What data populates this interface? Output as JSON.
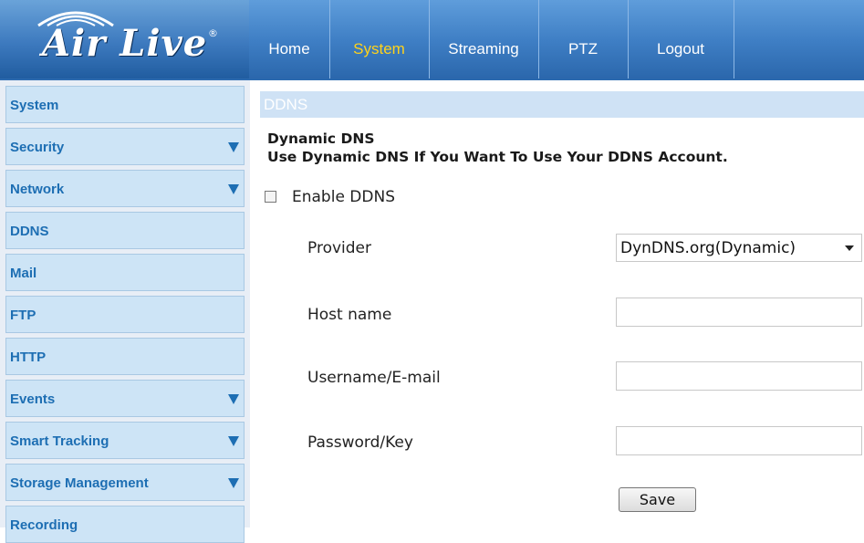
{
  "brand": {
    "logo_text": "Air Live",
    "logo_mark": "®"
  },
  "nav": {
    "tabs": [
      {
        "label": "Home"
      },
      {
        "label": "System",
        "active": true
      },
      {
        "label": "Streaming"
      },
      {
        "label": "PTZ"
      },
      {
        "label": "Logout"
      }
    ]
  },
  "sidebar": {
    "items": [
      {
        "label": "System",
        "expandable": false
      },
      {
        "label": "Security",
        "expandable": true
      },
      {
        "label": "Network",
        "expandable": true
      },
      {
        "label": "DDNS",
        "expandable": false
      },
      {
        "label": "Mail",
        "expandable": false
      },
      {
        "label": "FTP",
        "expandable": false
      },
      {
        "label": "HTTP",
        "expandable": false
      },
      {
        "label": "Events",
        "expandable": true
      },
      {
        "label": "Smart Tracking",
        "expandable": true
      },
      {
        "label": "Storage Management",
        "expandable": true
      },
      {
        "label": "Recording",
        "expandable": false
      }
    ]
  },
  "page": {
    "section_title": "DDNS",
    "heading": "Dynamic DNS",
    "subheading": "Use Dynamic DNS If You Want To Use Your DDNS Account.",
    "enable_label": "Enable DDNS",
    "enable_checked": false,
    "provider_label": "Provider",
    "provider_value": "DynDNS.org(Dynamic)",
    "hostname_label": "Host name",
    "hostname_value": "",
    "username_label": "Username/E-mail",
    "username_value": "",
    "password_label": "Password/Key",
    "password_value": "",
    "save_label": "Save"
  },
  "colors": {
    "nav_blue": "#3f7fc5",
    "active_tab": "#ffd21a",
    "sidebar_item_bg": "#cde4f6",
    "sidebar_text": "#1d6eb3",
    "section_bar": "#cfe2f5"
  },
  "icons": {
    "dropdown": "triangle-down",
    "expand": "triangle-down"
  }
}
